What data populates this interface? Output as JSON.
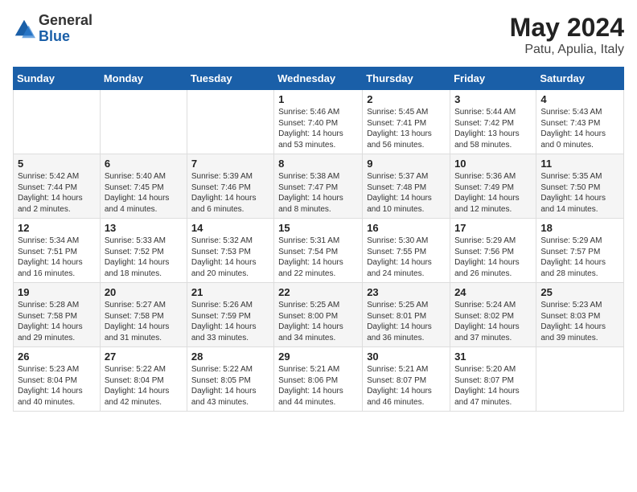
{
  "logo": {
    "general": "General",
    "blue": "Blue"
  },
  "title": {
    "month": "May 2024",
    "location": "Patu, Apulia, Italy"
  },
  "weekdays": [
    "Sunday",
    "Monday",
    "Tuesday",
    "Wednesday",
    "Thursday",
    "Friday",
    "Saturday"
  ],
  "weeks": [
    [
      {
        "day": "",
        "info": ""
      },
      {
        "day": "",
        "info": ""
      },
      {
        "day": "",
        "info": ""
      },
      {
        "day": "1",
        "info": "Sunrise: 5:46 AM\nSunset: 7:40 PM\nDaylight: 14 hours\nand 53 minutes."
      },
      {
        "day": "2",
        "info": "Sunrise: 5:45 AM\nSunset: 7:41 PM\nDaylight: 13 hours\nand 56 minutes."
      },
      {
        "day": "3",
        "info": "Sunrise: 5:44 AM\nSunset: 7:42 PM\nDaylight: 13 hours\nand 58 minutes."
      },
      {
        "day": "4",
        "info": "Sunrise: 5:43 AM\nSunset: 7:43 PM\nDaylight: 14 hours\nand 0 minutes."
      }
    ],
    [
      {
        "day": "5",
        "info": "Sunrise: 5:42 AM\nSunset: 7:44 PM\nDaylight: 14 hours\nand 2 minutes."
      },
      {
        "day": "6",
        "info": "Sunrise: 5:40 AM\nSunset: 7:45 PM\nDaylight: 14 hours\nand 4 minutes."
      },
      {
        "day": "7",
        "info": "Sunrise: 5:39 AM\nSunset: 7:46 PM\nDaylight: 14 hours\nand 6 minutes."
      },
      {
        "day": "8",
        "info": "Sunrise: 5:38 AM\nSunset: 7:47 PM\nDaylight: 14 hours\nand 8 minutes."
      },
      {
        "day": "9",
        "info": "Sunrise: 5:37 AM\nSunset: 7:48 PM\nDaylight: 14 hours\nand 10 minutes."
      },
      {
        "day": "10",
        "info": "Sunrise: 5:36 AM\nSunset: 7:49 PM\nDaylight: 14 hours\nand 12 minutes."
      },
      {
        "day": "11",
        "info": "Sunrise: 5:35 AM\nSunset: 7:50 PM\nDaylight: 14 hours\nand 14 minutes."
      }
    ],
    [
      {
        "day": "12",
        "info": "Sunrise: 5:34 AM\nSunset: 7:51 PM\nDaylight: 14 hours\nand 16 minutes."
      },
      {
        "day": "13",
        "info": "Sunrise: 5:33 AM\nSunset: 7:52 PM\nDaylight: 14 hours\nand 18 minutes."
      },
      {
        "day": "14",
        "info": "Sunrise: 5:32 AM\nSunset: 7:53 PM\nDaylight: 14 hours\nand 20 minutes."
      },
      {
        "day": "15",
        "info": "Sunrise: 5:31 AM\nSunset: 7:54 PM\nDaylight: 14 hours\nand 22 minutes."
      },
      {
        "day": "16",
        "info": "Sunrise: 5:30 AM\nSunset: 7:55 PM\nDaylight: 14 hours\nand 24 minutes."
      },
      {
        "day": "17",
        "info": "Sunrise: 5:29 AM\nSunset: 7:56 PM\nDaylight: 14 hours\nand 26 minutes."
      },
      {
        "day": "18",
        "info": "Sunrise: 5:29 AM\nSunset: 7:57 PM\nDaylight: 14 hours\nand 28 minutes."
      }
    ],
    [
      {
        "day": "19",
        "info": "Sunrise: 5:28 AM\nSunset: 7:58 PM\nDaylight: 14 hours\nand 29 minutes."
      },
      {
        "day": "20",
        "info": "Sunrise: 5:27 AM\nSunset: 7:58 PM\nDaylight: 14 hours\nand 31 minutes."
      },
      {
        "day": "21",
        "info": "Sunrise: 5:26 AM\nSunset: 7:59 PM\nDaylight: 14 hours\nand 33 minutes."
      },
      {
        "day": "22",
        "info": "Sunrise: 5:25 AM\nSunset: 8:00 PM\nDaylight: 14 hours\nand 34 minutes."
      },
      {
        "day": "23",
        "info": "Sunrise: 5:25 AM\nSunset: 8:01 PM\nDaylight: 14 hours\nand 36 minutes."
      },
      {
        "day": "24",
        "info": "Sunrise: 5:24 AM\nSunset: 8:02 PM\nDaylight: 14 hours\nand 37 minutes."
      },
      {
        "day": "25",
        "info": "Sunrise: 5:23 AM\nSunset: 8:03 PM\nDaylight: 14 hours\nand 39 minutes."
      }
    ],
    [
      {
        "day": "26",
        "info": "Sunrise: 5:23 AM\nSunset: 8:04 PM\nDaylight: 14 hours\nand 40 minutes."
      },
      {
        "day": "27",
        "info": "Sunrise: 5:22 AM\nSunset: 8:04 PM\nDaylight: 14 hours\nand 42 minutes."
      },
      {
        "day": "28",
        "info": "Sunrise: 5:22 AM\nSunset: 8:05 PM\nDaylight: 14 hours\nand 43 minutes."
      },
      {
        "day": "29",
        "info": "Sunrise: 5:21 AM\nSunset: 8:06 PM\nDaylight: 14 hours\nand 44 minutes."
      },
      {
        "day": "30",
        "info": "Sunrise: 5:21 AM\nSunset: 8:07 PM\nDaylight: 14 hours\nand 46 minutes."
      },
      {
        "day": "31",
        "info": "Sunrise: 5:20 AM\nSunset: 8:07 PM\nDaylight: 14 hours\nand 47 minutes."
      },
      {
        "day": "",
        "info": ""
      }
    ]
  ]
}
